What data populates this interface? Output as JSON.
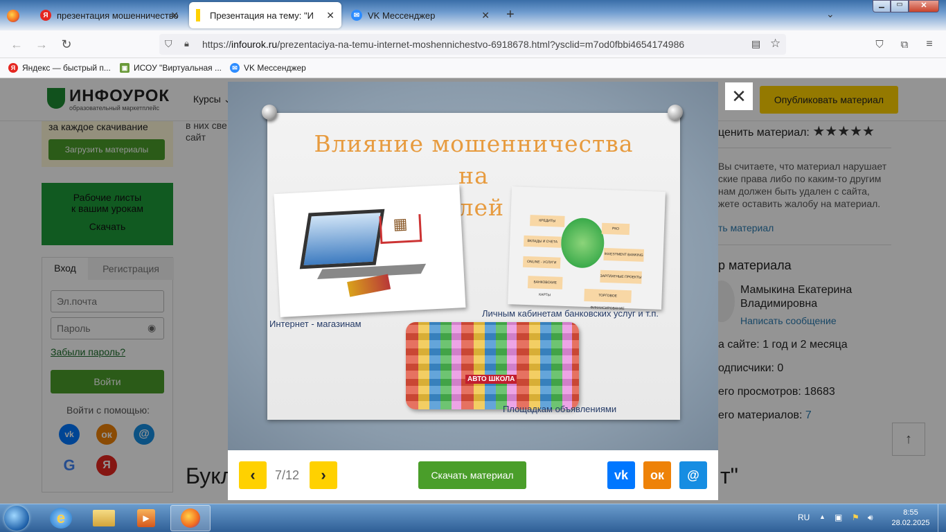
{
  "browser": {
    "tabs": [
      {
        "title": "презентация мошенничество"
      },
      {
        "title": "Презентация на тему: \"Интернет"
      },
      {
        "title": "VK Мессенджер"
      }
    ],
    "new_tab_symbol": "+",
    "url": {
      "prefix": "https://",
      "domain": "infourok.ru",
      "path": "/prezentaciya-na-temu-internet-moshennichestvo-6918678.html?ysclid=m7od0fbbi4654174986"
    },
    "bookmarks": [
      {
        "label": "Яндекс — быстрый п...",
        "icon": "yandex-icon"
      },
      {
        "label": "ИСОУ \"Виртуальная ...",
        "icon": "isou-icon"
      },
      {
        "label": "VK Мессенджер",
        "icon": "vk-messenger-icon"
      }
    ]
  },
  "site": {
    "logo_main": "ИНФОУРОК",
    "logo_sub": "образовательный маркетплейс",
    "nav_courses": "Курсы",
    "publish_button": "Опубликовать материал",
    "left": {
      "promo_text": "за каждое скачивание",
      "upload_button": "Загрузить материалы",
      "worksheets_line1": "Рабочие листы",
      "worksheets_line2": "к вашим урокам",
      "worksheets_download": "Скачать",
      "tab_login": "Вход",
      "tab_register": "Регистрация",
      "email_placeholder": "Эл.почта",
      "password_placeholder": "Пароль",
      "forgot": "Забыли пароль?",
      "login_button": "Войти",
      "login_with": "Войти с помощью:"
    },
    "middle_text_1": "в них све",
    "middle_text_2": "сайт",
    "booklet_title": "Букл",
    "booklet_tail": "т\"",
    "right": {
      "rate_label": "ценить материал:",
      "report_text": [
        "Вы считаете, что материал нарушает",
        "ские права либо по каким-то другим",
        "нам должен быть удален с сайта,",
        "жете оставить жалобу на материал."
      ],
      "report_link": "ть материал",
      "author_heading": "р материала",
      "author_name_1": "Мамыкина Екатерина",
      "author_name_2": "Владимировна",
      "write_message": "Написать сообщение",
      "on_site": "а сайте: 1 год и 2 месяца",
      "subscribers": "одписчики: 0",
      "views": "его просмотров: 18683",
      "materials_label": "его материалов: ",
      "materials_count": "7"
    }
  },
  "slide": {
    "title_line1": "Влияние  мошенничества  на",
    "title_line2": "пользователей  интернет",
    "caption_shops": "Интернет - магазинам",
    "caption_banks": "Личным кабинетам банковских услуг и т.п.",
    "caption_ads": "Площадкам  объявлениями",
    "bank_labels": [
      "КРЕДИТЫ",
      "РКО",
      "ВКЛАДЫ И СЧЕТА",
      "INVESTMENT BANKING",
      "ONLINE - УСЛУГИ",
      "ЗАРПЛАТНЫЕ ПРОЕКТЫ",
      "БАНКОВСКИЕ КАРТЫ",
      "ТОРГОВОЕ ФИНАНСИРОВАНИЕ"
    ],
    "ads_label": "АВТО ШКОЛА"
  },
  "viewer": {
    "page_indicator": "7/12",
    "download_button": "Скачать материал",
    "close_symbol": "✕",
    "prev_symbol": "‹",
    "next_symbol": "›"
  },
  "taskbar": {
    "lang": "RU",
    "time": "8:55",
    "date": "28.02.2025"
  },
  "colors": {
    "accent_green": "#4a9e2a",
    "yellow": "#ffd100",
    "vk": "#0077ff",
    "ok": "#ee8208",
    "mail": "#168de2"
  }
}
